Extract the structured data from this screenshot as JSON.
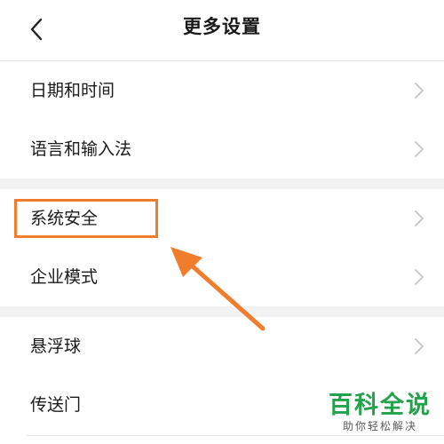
{
  "header": {
    "title": "更多设置",
    "back_icon": "chevron-left-icon"
  },
  "groups": [
    {
      "items": [
        {
          "label": "日期和时间"
        },
        {
          "label": "语言和输入法"
        }
      ]
    },
    {
      "items": [
        {
          "label": "系统安全"
        },
        {
          "label": "企业模式"
        }
      ]
    },
    {
      "items": [
        {
          "label": "悬浮球"
        },
        {
          "label": "传送门"
        }
      ]
    }
  ],
  "annotation": {
    "highlighted_item": "系统安全",
    "color": "#f07d2c"
  },
  "watermark": {
    "main": "百科全说",
    "sub": "助你轻松解决",
    "color": "#23a24c"
  },
  "colors": {
    "background": "#f2f2f2",
    "card": "#ffffff",
    "chevron": "#c4c4c4"
  }
}
